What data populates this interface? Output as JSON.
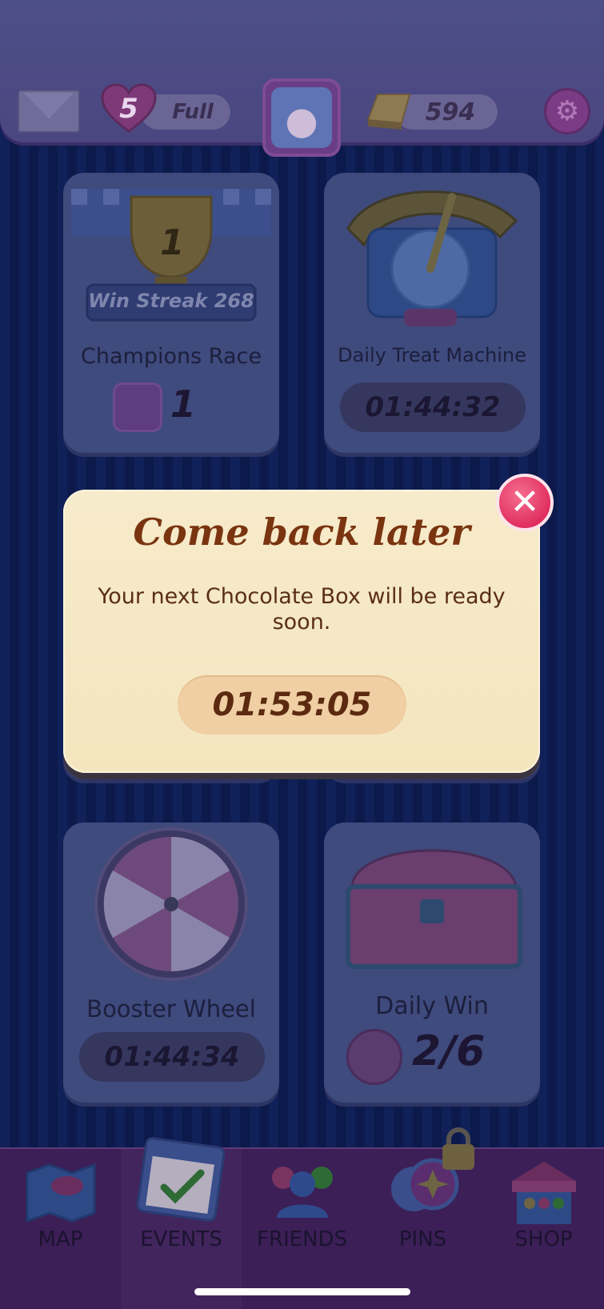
{
  "hud": {
    "lives_count": "5",
    "lives_status": "Full",
    "gold_count": "594"
  },
  "cards": {
    "champions_race": {
      "banner": "Win Streak 268",
      "title": "Champions Race",
      "rank": "1",
      "trophy_number": "1"
    },
    "daily_treat_machine": {
      "title": "Daily Treat Machine",
      "timer": "01:44:32"
    },
    "booster_wheel": {
      "title": "Booster Wheel",
      "timer": "01:44:34"
    },
    "daily_win": {
      "title": "Daily Win",
      "progress": "2/6"
    }
  },
  "dialog": {
    "title": "Come back later",
    "message": "Your next Chocolate Box will be ready soon.",
    "timer": "01:53:05"
  },
  "nav": {
    "items": [
      {
        "label": "MAP"
      },
      {
        "label": "EVENTS"
      },
      {
        "label": "FRIENDS"
      },
      {
        "label": "PINS"
      },
      {
        "label": "SHOP"
      }
    ]
  }
}
